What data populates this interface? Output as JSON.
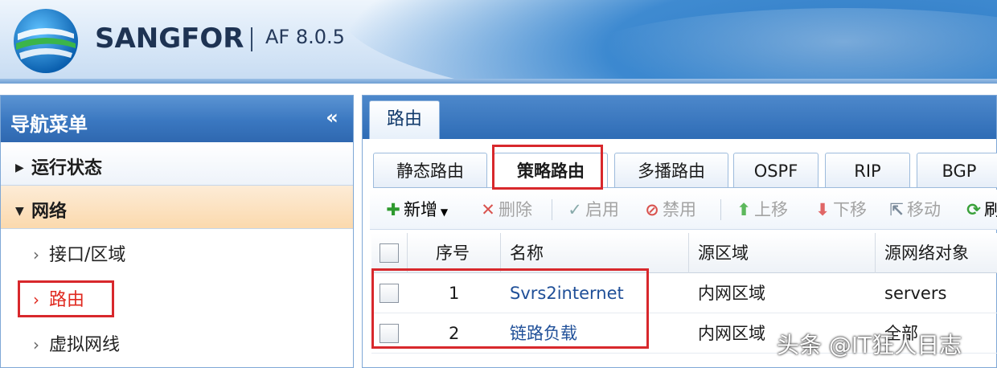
{
  "header": {
    "brand": "SANGFOR",
    "version": "AF 8.0.5"
  },
  "sidebar": {
    "title": "导航菜单",
    "collapse_glyph": "«",
    "sections": [
      {
        "label": "运行状态",
        "expanded": false
      },
      {
        "label": "网络",
        "expanded": true
      }
    ],
    "items": [
      {
        "label": "接口/区域"
      },
      {
        "label": "路由",
        "active": true
      },
      {
        "label": "虚拟网线"
      }
    ]
  },
  "main_tab": {
    "label": "路由"
  },
  "subtabs": [
    {
      "label": "静态路由"
    },
    {
      "label": "策略路由",
      "active": true
    },
    {
      "label": "多播路由"
    },
    {
      "label": "OSPF"
    },
    {
      "label": "RIP"
    },
    {
      "label": "BGP"
    }
  ],
  "toolbar": {
    "add": "新增",
    "delete": "删除",
    "enable": "启用",
    "disable": "禁用",
    "move_up": "上移",
    "move_down": "下移",
    "move": "移动",
    "refresh_partial": "刷"
  },
  "table": {
    "columns": [
      "序号",
      "名称",
      "源区域",
      "源网络对象"
    ],
    "rows": [
      {
        "index": "1",
        "name": "Svrs2internet",
        "src_zone": "内网区域",
        "src_object": "servers"
      },
      {
        "index": "2",
        "name": "链路负载",
        "src_zone": "内网区域",
        "src_object": "全部"
      }
    ]
  },
  "watermark": "头条 @IT狂人日志",
  "colors": {
    "accent_blue": "#2e6cb6",
    "highlight_red": "#d8282c",
    "active_section": "#fbd9ad"
  }
}
